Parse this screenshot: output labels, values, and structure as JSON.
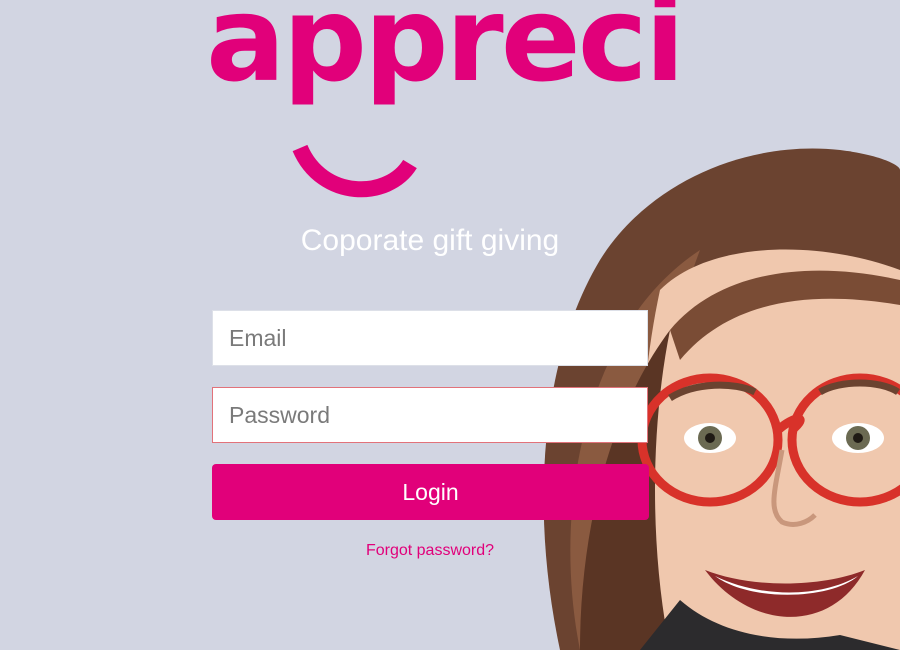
{
  "brand": {
    "logo_text": "appreci",
    "accent_color": "#e1007a"
  },
  "tagline": "Coporate gift giving",
  "form": {
    "email": {
      "value": "",
      "placeholder": "Email"
    },
    "password": {
      "value": "",
      "placeholder": "Password"
    },
    "login_label": "Login",
    "forgot_label": "Forgot password?"
  },
  "background": {
    "color": "#d2d5e2",
    "photo": "smiling-woman-with-red-glasses"
  }
}
